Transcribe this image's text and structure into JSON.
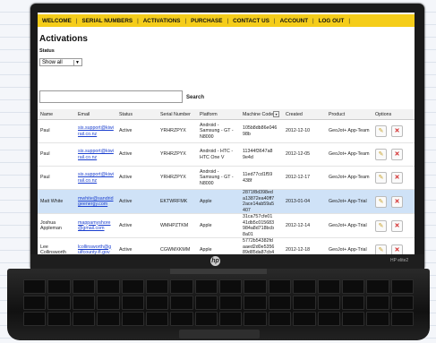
{
  "nav": {
    "items": [
      "WELCOME",
      "SERIAL NUMBERS",
      "ACTIVATIONS",
      "PURCHASE",
      "CONTACT US",
      "ACCOUNT",
      "LOG OUT"
    ]
  },
  "page": {
    "title": "Activations",
    "status_label": "Status",
    "status_value": "Show all",
    "search_label": "Search"
  },
  "table": {
    "headers": [
      "Name",
      "Email",
      "Status",
      "Serial Number",
      "Platform",
      "Machine Code",
      "Created",
      "Product",
      "Options"
    ],
    "rows": [
      {
        "name": "Paul",
        "email": "sis.support@kiwirail.co.nz",
        "status": "Active",
        "serial": "YRHRZPYX",
        "platform": "Android - Samsung - GT -N8000",
        "machine": "105b8db86e046 98b",
        "created": "2012-12-10",
        "product": "GeoJot+ App-Team"
      },
      {
        "name": "Paul",
        "email": "sis.support@kiwirail.co.nz",
        "status": "Active",
        "serial": "YRHRZPYX",
        "platform": "Android - HTC - HTC One V",
        "machine": "11344f3647a8 9e4d",
        "created": "2012-12-05",
        "product": "GeoJot+ App-Team"
      },
      {
        "name": "Paul",
        "email": "sis.support@kiwirail.co.nz",
        "status": "Active",
        "serial": "YRHRZPYX",
        "platform": "Android - Samsung - GT -N8000",
        "machine": "11ed77cd1f59 438f",
        "created": "2012-12-17",
        "product": "GeoJot+ App-Team"
      },
      {
        "name": "Matt White",
        "email": "mwhite@sandridgeenergy.com",
        "status": "Active",
        "serial": "EKTWRFMK",
        "platform": "Apple",
        "machine": "2871f8d398ed a13872ea40ff7 2ace14ab59a5 407",
        "created": "2013-01-04",
        "product": "GeoJot+ App-Trial",
        "highlight": true
      },
      {
        "name": "Joshua Appleman",
        "email": "mappamyshore@gmail.com",
        "status": "Active",
        "serial": "WMHPZTKM",
        "platform": "Apple",
        "machine": "31ca757cfe01 41db5c015683 984a8d718bcb 8a01",
        "created": "2012-12-14",
        "product": "GeoJot+ App-Trial"
      },
      {
        "name": "Lee Collinsworth",
        "email": "lcollinsworth@gulfcounty-fl.gov",
        "status": "Active",
        "serial": "CGWMXKMM",
        "platform": "Apple",
        "machine": "5772b54382fd aaed2d0e5356 89d85da87cb4 5e4d",
        "created": "2012-12-18",
        "product": "GeoJot+ App-Trial"
      }
    ]
  },
  "laptop": {
    "logo": "hp",
    "model": "HP elite2"
  },
  "colors": {
    "nav": "#f5cd1a",
    "highlight_row": "#cfe2f7",
    "link": "#1a3fcf",
    "delete": "#d02020"
  }
}
